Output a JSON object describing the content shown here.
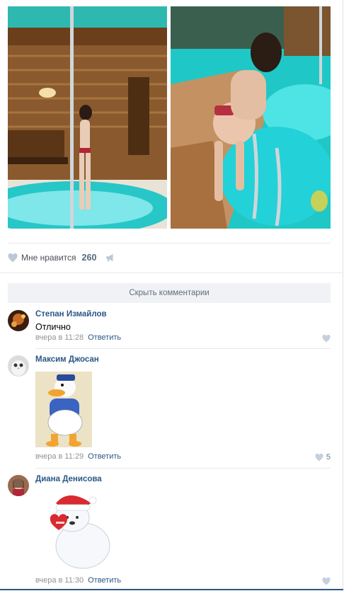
{
  "likes": {
    "label": "Мне нравится",
    "count": "260"
  },
  "hide_comments_label": "Скрыть комментарии",
  "comments": [
    {
      "author": "Степан Измайлов",
      "text": "Отлично",
      "time": "вчера в 11:28",
      "reply": "Ответить",
      "likes": ""
    },
    {
      "author": "Максим Джосан",
      "time": "вчера в 11:29",
      "reply": "Ответить",
      "likes": "5",
      "sticker": "donald-duck-sticker"
    },
    {
      "author": "Диана Денисова",
      "time": "вчера в 11:30",
      "reply": "Ответить",
      "likes": "",
      "sticker": "polar-bear-sticker"
    }
  ],
  "icons": [
    "heart-icon",
    "share-icon"
  ],
  "colors": {
    "link": "#2a5885",
    "meta": "#939393",
    "button_bg": "#f0f2f5",
    "pool": "#27c7c7"
  }
}
